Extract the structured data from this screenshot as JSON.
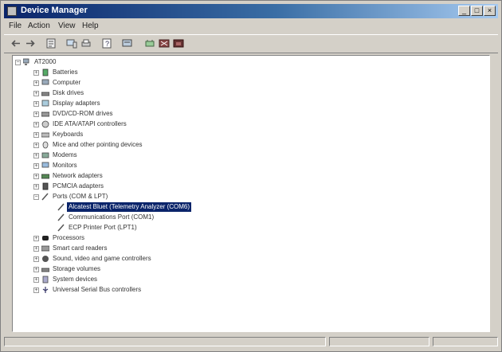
{
  "window": {
    "title": "Device Manager"
  },
  "menu": [
    "File",
    "Action",
    "View",
    "Help"
  ],
  "toolbar_icons": [
    "back-arrow-icon",
    "forward-arrow-icon",
    "properties-icon",
    "computer-icon",
    "print-icon",
    "help-icon",
    "scan-hardware-icon",
    "update-driver-icon",
    "disable-icon",
    "uninstall-icon"
  ],
  "tree": {
    "root": "AT2000",
    "categories": [
      "Batteries",
      "Computer",
      "Disk drives",
      "Display adapters",
      "DVD/CD-ROM drives",
      "IDE ATA/ATAPI controllers",
      "Keyboards",
      "Mice and other pointing devices",
      "Modems",
      "Monitors",
      "Network adapters",
      "PCMCIA adapters",
      "Ports (COM & LPT)"
    ],
    "ports_children": [
      "Alcatest Bluet (Telemetry Analyzer (COM6)",
      "Communications Port (COM1)",
      "ECP Printer Port (LPT1)"
    ],
    "categories_after": [
      "Processors",
      "Smart card readers",
      "Sound, video and game controllers",
      "Storage volumes",
      "System devices",
      "Universal Serial Bus controllers"
    ],
    "selected": "Alcatest Bluet (Telemetry Analyzer (COM6)"
  }
}
